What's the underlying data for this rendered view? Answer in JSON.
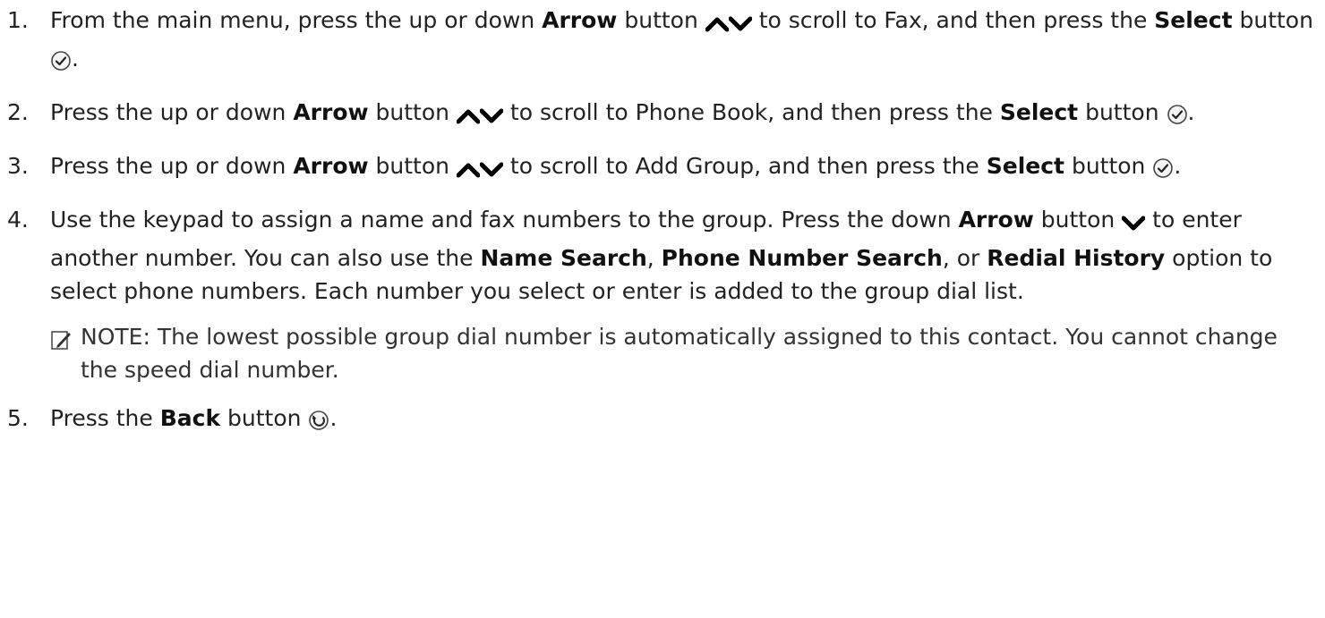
{
  "steps": [
    {
      "num": "1.",
      "t1": "From the main menu, press the up or down ",
      "b1": "Arrow",
      "t2": " button ",
      "t3": " to scroll to Fax, and then press the ",
      "b2": "Select",
      "t4": " button ",
      "t5": "."
    },
    {
      "num": "2.",
      "t1": "Press the up or down ",
      "b1": "Arrow",
      "t2": " button ",
      "t3": " to scroll to Phone Book, and then press the ",
      "b2": "Select",
      "t4": " button ",
      "t5": "."
    },
    {
      "num": "3.",
      "t1": "Press the up or down ",
      "b1": "Arrow",
      "t2": " button ",
      "t3": " to scroll to Add Group, and then press the ",
      "b2": "Select",
      "t4": " button ",
      "t5": "."
    },
    {
      "num": "4.",
      "t1": "Use the keypad to assign a name and fax numbers to the group. Press the down ",
      "b1": "Arrow",
      "t2": " button ",
      "t3": " to enter another number. You can also use the ",
      "b2": "Name Search",
      "t4": ", ",
      "b3": "Phone Number Search",
      "t5": ", or ",
      "b4": "Redial History",
      "t6": " option to select phone numbers. Each number you select or enter is added to the group dial list.",
      "note": "NOTE: The lowest possible group dial number is automatically assigned to this contact. You cannot change the speed dial number."
    },
    {
      "num": "5.",
      "t1": "Press the ",
      "b1": "Back",
      "t2": " button ",
      "t3": "."
    }
  ],
  "icons": {
    "arrow_up": "up-arrow-icon",
    "arrow_down": "down-arrow-icon",
    "select": "select-check-icon",
    "back": "back-icon",
    "note": "note-pencil-icon"
  }
}
